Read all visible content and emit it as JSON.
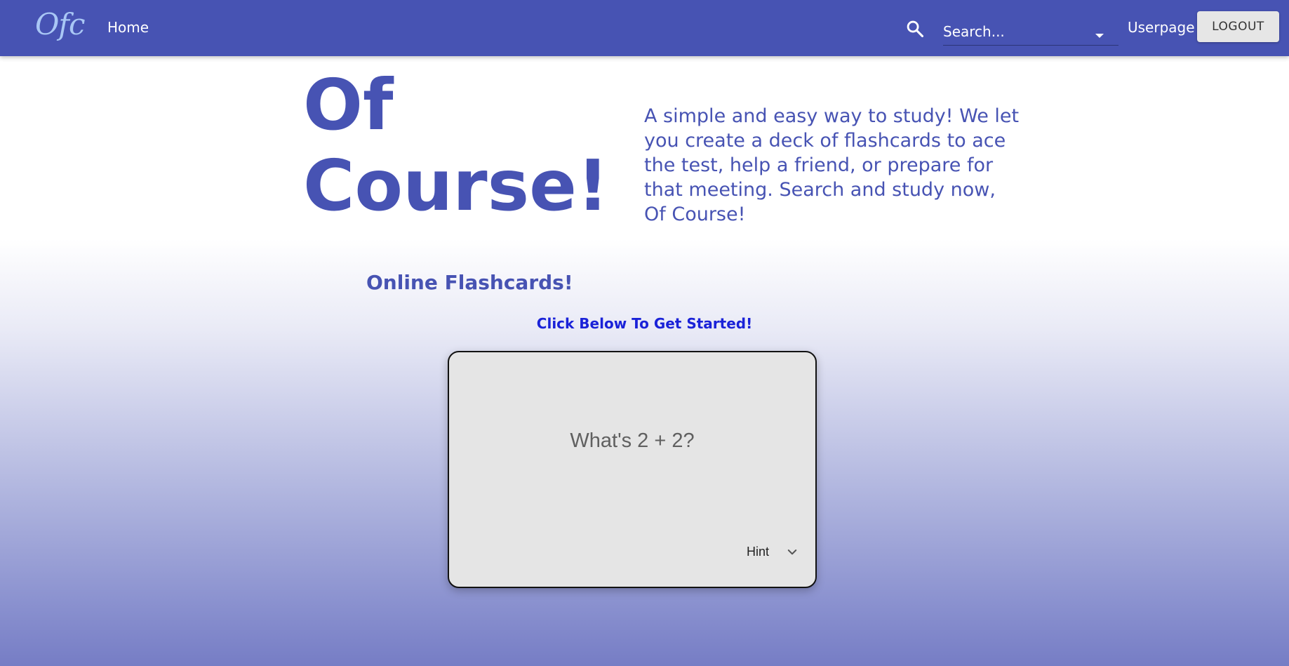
{
  "header": {
    "logo": "Ofc",
    "home_label": "Home",
    "search_placeholder": "Search...",
    "userpage_label": "Userpage",
    "logout_label": "LOGOUT"
  },
  "hero": {
    "title": "Of Course!",
    "description": "A simple and easy way to study! We let you create a deck of flashcards to ace the test, help a friend, or prepare for that meeting. Search and study now, Of Course!"
  },
  "main": {
    "heading": "Online Flashcards!",
    "cta_text": "Click Below To Get Started!",
    "flashcard": {
      "question": "What's 2 + 2?",
      "hint_label": "Hint"
    }
  },
  "colors": {
    "brand": "#4753b3",
    "logo": "#a9c7f5",
    "cta": "#1a22d8",
    "card": "#e5e5e5"
  },
  "icons": {
    "search": "search-icon",
    "dropdown": "dropdown-arrow-icon",
    "hint_toggle": "chevron-down-icon"
  }
}
